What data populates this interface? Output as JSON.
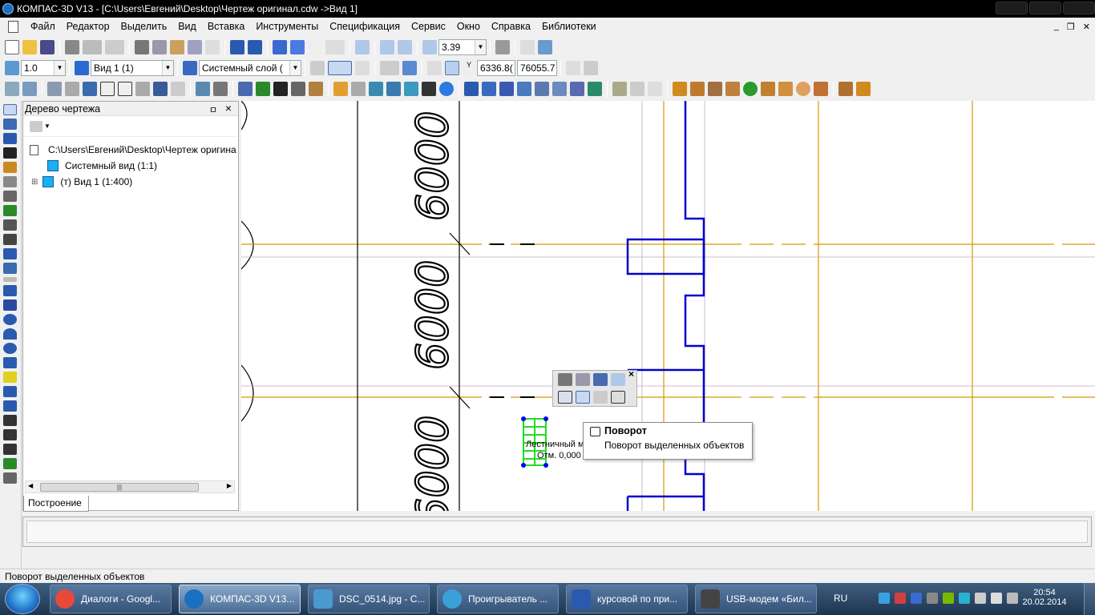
{
  "app": {
    "title": "КОМПАС-3D V13 - [C:\\Users\\Евгений\\Desktop\\Чертеж оригинал.cdw ->Вид 1]"
  },
  "menu": [
    "Файл",
    "Редактор",
    "Выделить",
    "Вид",
    "Вставка",
    "Инструменты",
    "Спецификация",
    "Сервис",
    "Окно",
    "Справка",
    "Библиотеки"
  ],
  "toolbar1": {
    "zoom_value": "3.39"
  },
  "toolbar2": {
    "step_value": "1.0",
    "view_value": "Вид 1 (1)",
    "layer_value": "Системный слой (",
    "coord_label": "Y",
    "coord_x": "6336.8(",
    "coord_y": "76055.7"
  },
  "tree_panel": {
    "title": "Дерево чертежа",
    "pin": "ㅁ",
    "close": "×",
    "nodes": [
      {
        "label": "C:\\Users\\Евгений\\Desktop\\Чертеж оригина"
      },
      {
        "label": "Системный вид (1:1)"
      },
      {
        "label": "(т) Вид 1 (1:400)"
      }
    ],
    "expander": "⊞",
    "scroll_grip": "|||",
    "tab_label": "Построение"
  },
  "canvas": {
    "dimensions": [
      "6000",
      "6000",
      "6000"
    ],
    "element_label_1": "Лестничный м",
    "element_label_2": "Отм. 0,000"
  },
  "context_toolbar": {
    "close": "×"
  },
  "tooltip": {
    "title": "Поворот",
    "description": "Поворот выделенных объектов"
  },
  "status": {
    "text": "Поворот выделенных объектов"
  },
  "taskbar": {
    "items": [
      {
        "label": "Диалоги - Googl...",
        "icon_color": "#e84a3a"
      },
      {
        "label": "КОМПАС-3D V13...",
        "icon_color": "#1a6fc0"
      },
      {
        "label": "DSC_0514.jpg - С...",
        "icon_color": "#4a9ad0"
      },
      {
        "label": "Проигрыватель ...",
        "icon_color": "#3aa0d8"
      },
      {
        "label": "курсовой по при...",
        "icon_color": "#2a5ab0"
      },
      {
        "label": "USB-модем «Бил...",
        "icon_color": "#444444"
      }
    ],
    "language": "RU",
    "time": "20:54",
    "date": "20.02.2014"
  },
  "colors": {
    "axis_orange": "#d49a00",
    "wall_blue": "#0000cc",
    "selection_green": "#22dd22",
    "handle_blue": "#0000ff"
  }
}
